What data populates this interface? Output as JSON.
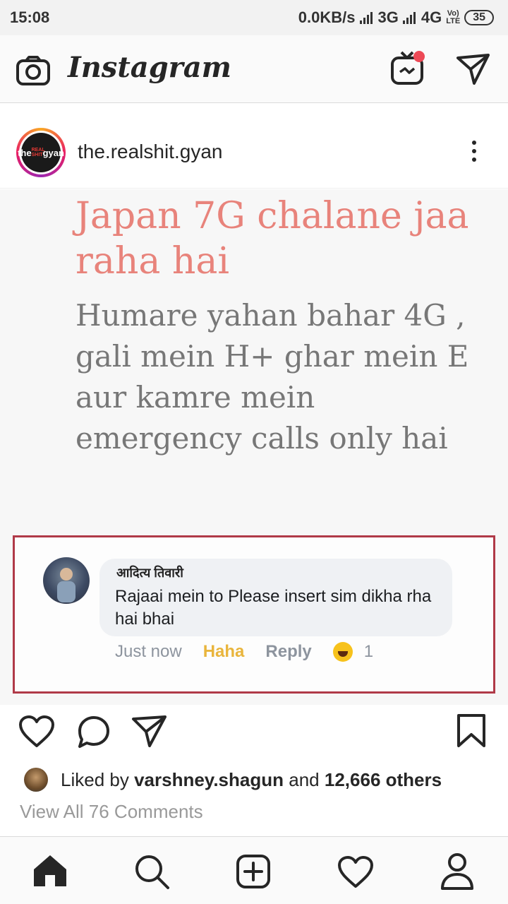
{
  "status_bar": {
    "time": "15:08",
    "speed": "0.0KB/s",
    "net1": "3G",
    "net2": "4G",
    "volte_top": "Vo)",
    "volte_bottom": "LTE",
    "battery": "35"
  },
  "app": {
    "title": "Instagram"
  },
  "post": {
    "username": "the.realshit.gyan",
    "avatar_text_left": "the",
    "avatar_text_mid": "REAL SHIT",
    "avatar_text_right": "gyan",
    "meme_heading": "Japan 7G chalane jaa raha hai",
    "meme_body": "Humare yahan bahar 4G , gali mein H+ ghar mein E aur kamre mein emergency calls only hai",
    "comment": {
      "author": "आदित्य तिवारी",
      "text": "Rajaai mein to Please insert sim dikha rha hai bhai",
      "time": "Just now",
      "reaction_label": "Haha",
      "reply_label": "Reply",
      "reaction_count": "1"
    },
    "liked_prefix": "Liked by ",
    "liked_user": "varshney.shagun",
    "liked_mid": " and ",
    "liked_count": "12,666 others",
    "view_comments": "View All 76 Comments"
  },
  "icons": {
    "camera": "camera-icon",
    "igtv": "igtv-icon",
    "direct": "direct-message-icon",
    "like": "heart-icon",
    "comment": "comment-icon",
    "share": "share-icon",
    "save": "bookmark-icon",
    "home": "home-icon",
    "search": "search-icon",
    "add": "add-post-icon",
    "activity": "activity-heart-icon",
    "profile": "profile-icon"
  },
  "colors": {
    "notification_dot": "#ed4956",
    "meme_heading": "#e8837b",
    "meme_body": "#777777",
    "comment_border": "#b03a48",
    "haha": "#e9b53c"
  }
}
